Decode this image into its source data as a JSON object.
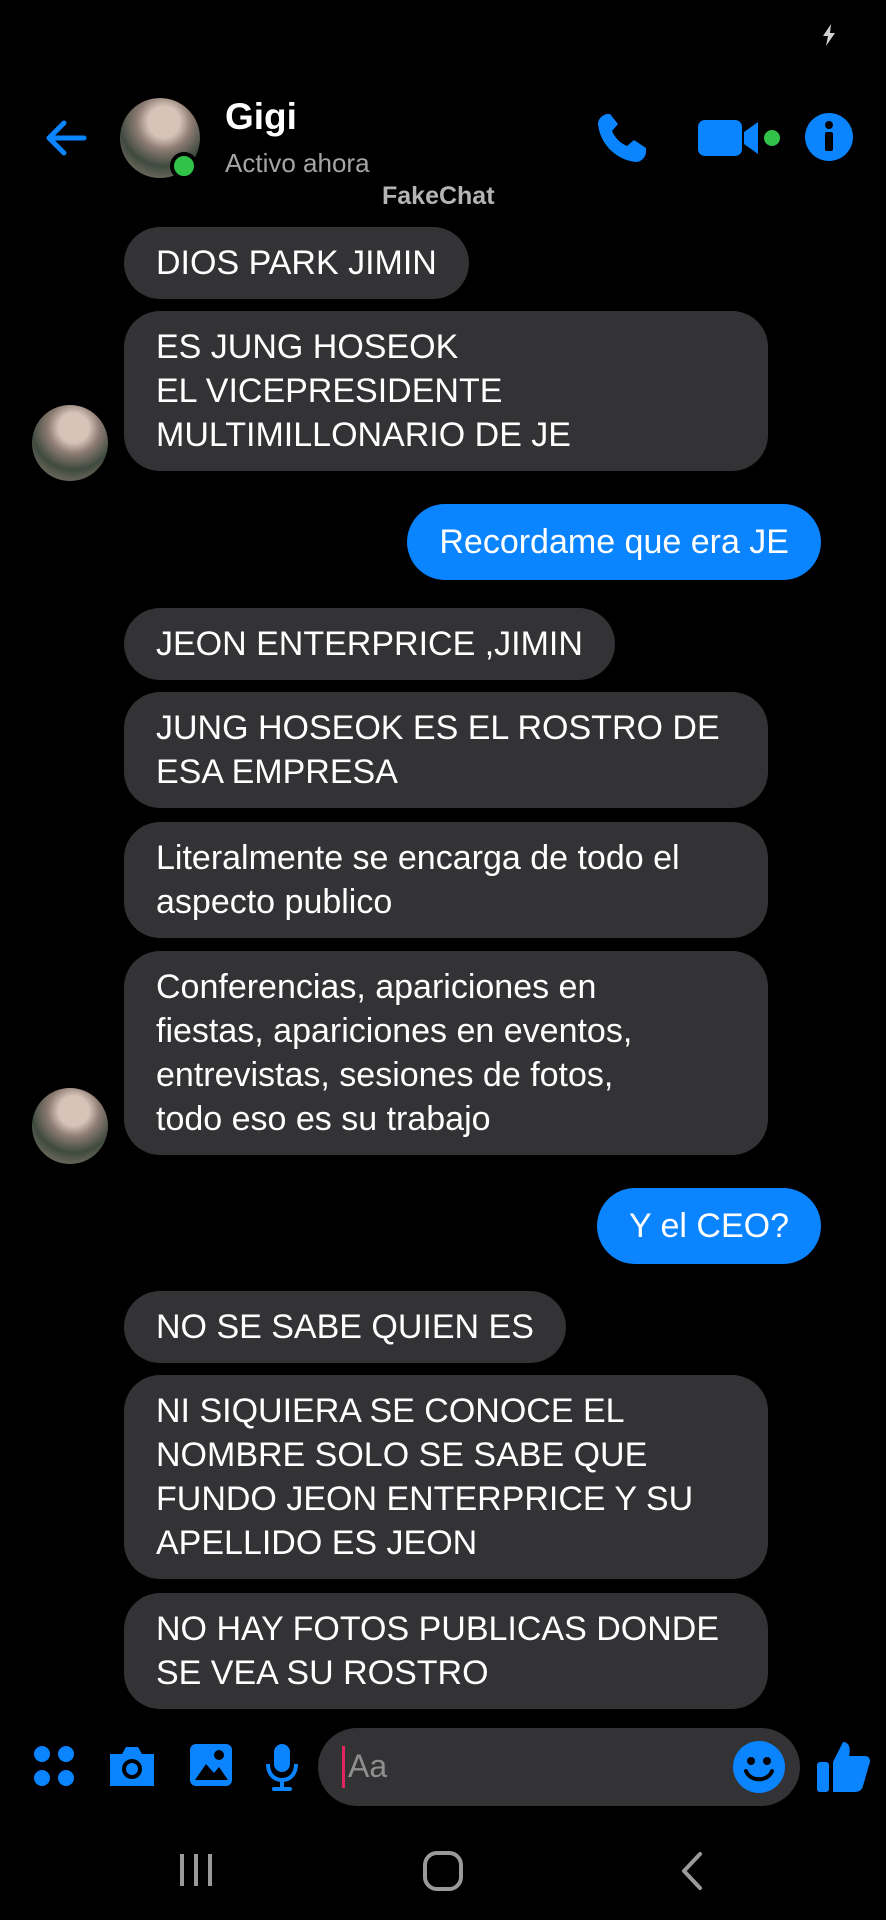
{
  "contact": {
    "name": "Gigi",
    "status": "Activo ahora",
    "watermark": "FakeChat"
  },
  "icons": {
    "back": "arrow-left-icon",
    "call": "phone-icon",
    "video": "video-camera-icon",
    "info": "info-icon",
    "apps": "apps-grid-icon",
    "camera": "camera-icon",
    "gallery": "image-icon",
    "mic": "microphone-icon",
    "emoji": "smiley-icon",
    "like": "thumbs-up-icon"
  },
  "colors": {
    "accent": "#0a84ff",
    "incoming_bubble": "#333336",
    "online": "#31c24a",
    "background": "#000000"
  },
  "messages": [
    {
      "from": "them",
      "text": "DIOS PARK JIMIN"
    },
    {
      "from": "them",
      "text": "ES JUNG HOSEOK\nEL VICEPRESIDENTE\nMULTIMILLONARIO DE JE"
    },
    {
      "from": "me",
      "text": "Recordame que era JE"
    },
    {
      "from": "them",
      "text": "JEON ENTERPRICE ,JIMIN"
    },
    {
      "from": "them",
      "text": "JUNG HOSEOK ES EL ROSTRO DE\nESA EMPRESA"
    },
    {
      "from": "them",
      "text": "Literalmente se encarga de todo el\naspecto publico"
    },
    {
      "from": "them",
      "text": "Conferencias, apariciones en\nfiestas, apariciones en eventos,\nentrevistas, sesiones de fotos,\ntodo eso es su trabajo"
    },
    {
      "from": "me",
      "text": "Y el CEO?"
    },
    {
      "from": "them",
      "text": "NO SE SABE QUIEN ES"
    },
    {
      "from": "them",
      "text": "NI SIQUIERA SE CONOCE EL\nNOMBRE SOLO SE SABE QUE\nFUNDO JEON ENTERPRICE Y SU\nAPELLIDO ES JEON"
    },
    {
      "from": "them",
      "text": "NO HAY FOTOS PUBLICAS DONDE\nSE VEA SU ROSTRO"
    }
  ],
  "composer": {
    "placeholder": "Aa"
  }
}
